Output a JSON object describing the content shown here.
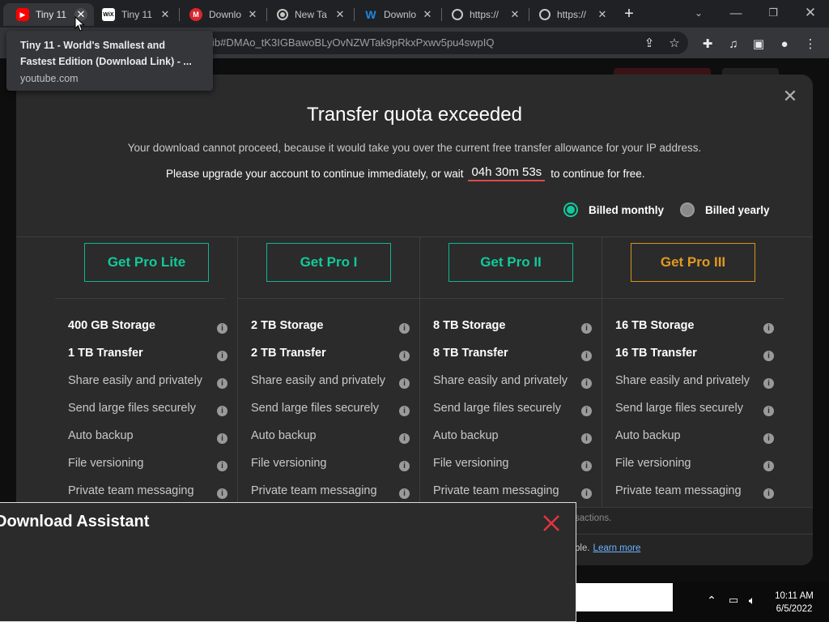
{
  "browser": {
    "tabs": [
      {
        "title": "Tiny 11",
        "favicon": "youtube-icon",
        "color": "#ff0000",
        "glyph": "▶",
        "active": true
      },
      {
        "title": "Tiny 11",
        "favicon": "wix-icon",
        "color": "#ffffff",
        "glyph": "WiX",
        "active": false
      },
      {
        "title": "Downlo",
        "favicon": "mega-icon",
        "color": "#d9272e",
        "glyph": "M",
        "active": false
      },
      {
        "title": "New Ta",
        "favicon": "chrome-icon",
        "color": "#9aa0a6",
        "glyph": "◉",
        "active": false
      },
      {
        "title": "Downlo",
        "favicon": "w-icon",
        "color": "#1e88e5",
        "glyph": "W",
        "active": false
      },
      {
        "title": "https://",
        "favicon": "globe-icon",
        "color": "#9aa0a6",
        "glyph": "◍",
        "active": false
      },
      {
        "title": "https://",
        "favicon": "globe-icon",
        "color": "#9aa0a6",
        "glyph": "◍",
        "active": false
      }
    ],
    "new_tab": "+",
    "url": "ib#DMAo_tK3IGBawoBLyOvNZWTak9pRkxPxwv5pu4swpIQ",
    "tooltip": {
      "title": "Tiny 11 - World's Smallest and Fastest Edition (Download Link) - ...",
      "url": "youtube.com"
    }
  },
  "modal": {
    "title": "Transfer quota exceeded",
    "description": "Your download cannot proceed, because it would take you over the current free transfer allowance for your IP address.",
    "upgrade_prefix": "Please upgrade your account to continue immediately, or wait",
    "timer": "04h 30m 53s",
    "upgrade_suffix": "to continue for free.",
    "billing": {
      "monthly": "Billed monthly",
      "yearly": "Billed yearly",
      "selected": "monthly",
      "accent": "#12c99b"
    },
    "plans": [
      {
        "button": "Get Pro Lite",
        "storage": "400 GB Storage",
        "transfer": "1 TB Transfer"
      },
      {
        "button": "Get Pro I",
        "storage": "2 TB Storage",
        "transfer": "2 TB Transfer"
      },
      {
        "button": "Get Pro II",
        "storage": "8 TB Storage",
        "transfer": "8 TB Transfer"
      },
      {
        "button": "Get Pro III",
        "storage": "16 TB Storage",
        "transfer": "16 TB Transfer"
      }
    ],
    "common_features": [
      "Share easily and privately",
      "Send large files securely",
      "Auto backup",
      "File versioning",
      "Private team messaging"
    ],
    "footer_line1": "sactions.",
    "footer_line2": "ble.",
    "learn_more": "Learn more"
  },
  "assistant": {
    "title": "Download Assistant",
    "close_color": "#e0343f"
  },
  "taskbar": {
    "time": "10:11 AM",
    "date": "6/5/2022"
  }
}
